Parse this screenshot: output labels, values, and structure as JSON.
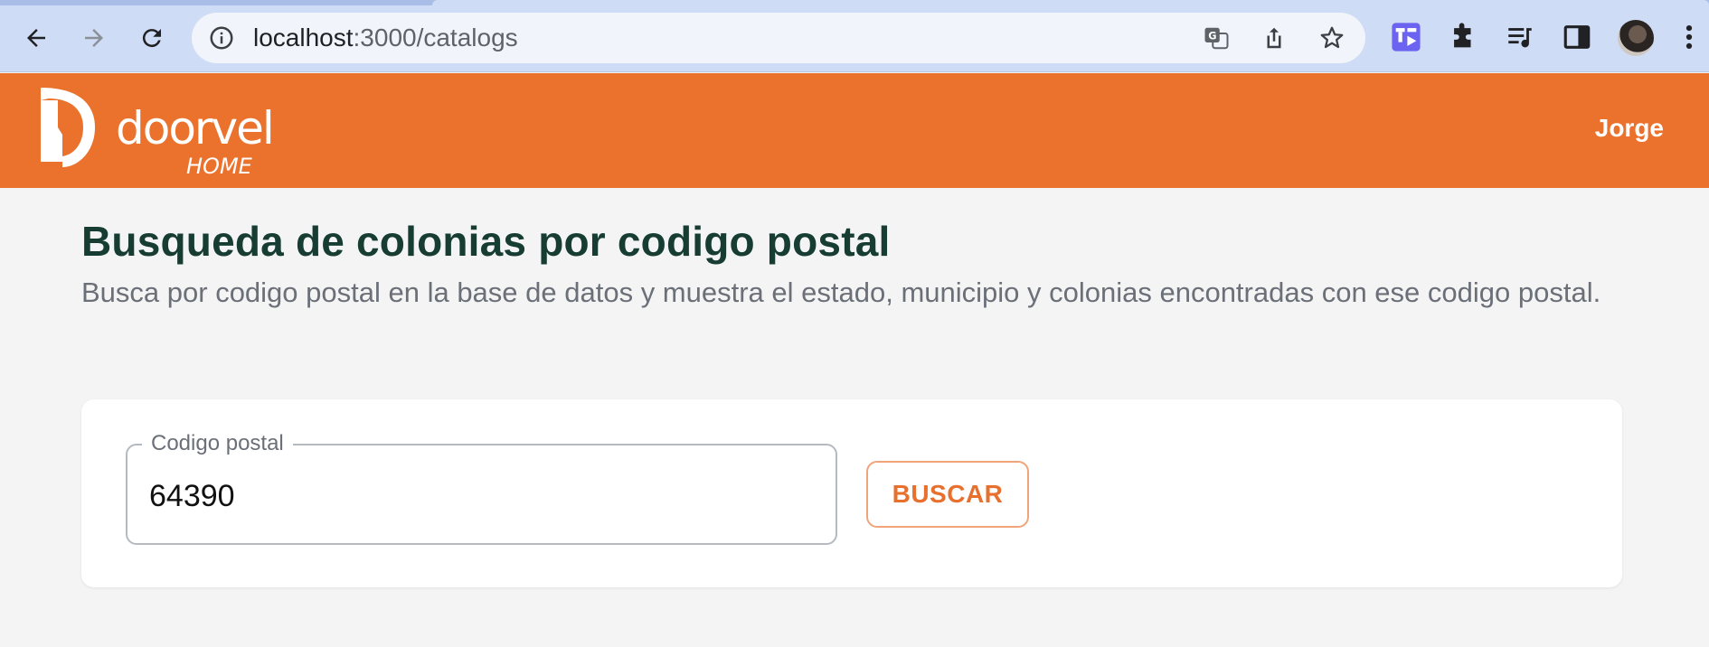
{
  "browser": {
    "url_host": "localhost",
    "url_path": ":3000/catalogs"
  },
  "app": {
    "logo_text": "doorvel",
    "logo_subtext": "HOME",
    "user_name": "Jorge",
    "brand_color": "#eb722d"
  },
  "page": {
    "title": "Busqueda de colonias por codigo postal",
    "description": "Busca por codigo postal en la base de datos y muestra el estado, municipio y colonias encontradas con ese codigo postal."
  },
  "search": {
    "label": "Codigo postal",
    "value": "64390",
    "button_label": "BUSCAR"
  },
  "icons": [
    "back-icon",
    "forward-icon",
    "reload-icon",
    "info-icon",
    "translate-icon",
    "share-icon",
    "bookmark-star-icon",
    "extension-icon",
    "puzzle-icon",
    "media-queue-icon",
    "side-panel-icon",
    "avatar"
  ]
}
